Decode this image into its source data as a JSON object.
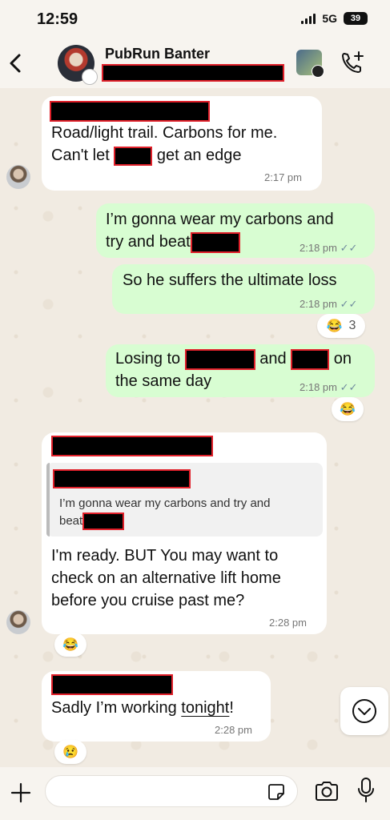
{
  "status_bar": {
    "time": "12:59",
    "network": "5G",
    "battery": "39"
  },
  "header": {
    "title": "PubRun Banter"
  },
  "messages": [
    {
      "id": "m1",
      "direction": "in",
      "lines": [
        "Road/light trail. Carbons for me.",
        "Can't let",
        "get an edge"
      ],
      "time": "2:17 pm"
    },
    {
      "id": "m2",
      "direction": "out",
      "lines": [
        "I’m gonna wear my carbons and",
        "try and beat"
      ],
      "time": "2:18 pm"
    },
    {
      "id": "m3",
      "direction": "out",
      "lines": [
        "So he suffers the ultimate loss"
      ],
      "time": "2:18 pm",
      "reaction": {
        "emoji": "😂",
        "count": "3"
      }
    },
    {
      "id": "m4",
      "direction": "out",
      "lines": [
        "Losing to",
        "and",
        "on",
        "the same day"
      ],
      "time": "2:18 pm",
      "reaction": {
        "emoji": "😂"
      }
    },
    {
      "id": "m5",
      "direction": "in",
      "quote": {
        "lines": [
          "I’m gonna wear my carbons and try and",
          "beat"
        ]
      },
      "lines": [
        "I'm ready. BUT You may want to",
        "check on an alternative lift home",
        "before you cruise past me?"
      ],
      "time": "2:28 pm",
      "reaction": {
        "emoji": "😂"
      }
    },
    {
      "id": "m6",
      "direction": "in",
      "lines": [
        "Sadly I’m working",
        "tonight",
        "!"
      ],
      "time": "2:28 pm",
      "reaction": {
        "emoji": "😢"
      }
    }
  ],
  "icons": {
    "back": "chevron-left-icon",
    "call": "add-call-icon",
    "scroll": "chevron-down-icon",
    "plus": "plus-icon",
    "sticker": "sticker-icon",
    "camera": "camera-icon",
    "mic": "microphone-icon"
  },
  "colors": {
    "outgoing_bubble": "#d8fdd2",
    "incoming_bubble": "#ffffff",
    "redaction_border": "#e0202a",
    "read_ticks": "#6f8a9e"
  }
}
